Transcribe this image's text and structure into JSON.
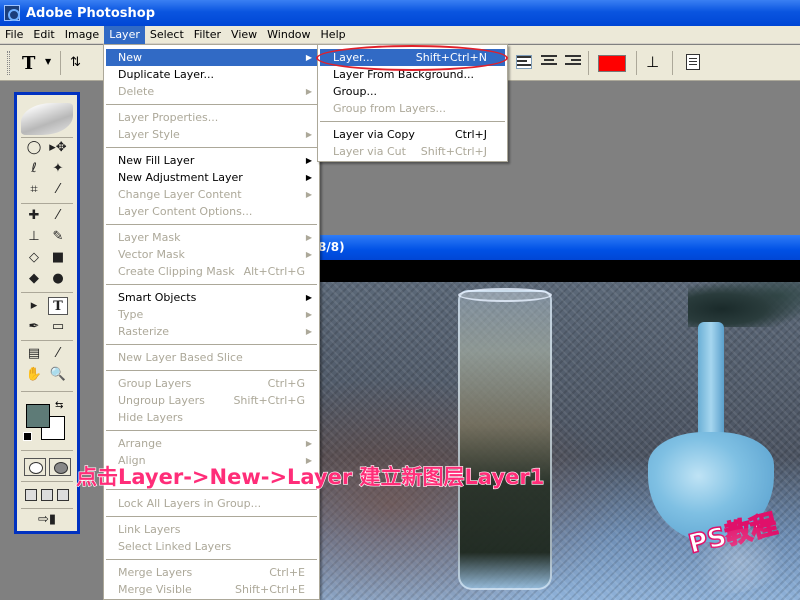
{
  "app": {
    "title": "Adobe Photoshop"
  },
  "menubar": {
    "items": [
      "File",
      "Edit",
      "Image",
      "Layer",
      "Select",
      "Filter",
      "View",
      "Window",
      "Help"
    ],
    "active": "Layer"
  },
  "options": {
    "type_tool_glyph": "T",
    "text_color": "#ff0000"
  },
  "document": {
    "title_fragment": "8/8)"
  },
  "layer_menu": {
    "items": [
      {
        "label": "New",
        "arrow": true,
        "disabled": false
      },
      {
        "label": "Duplicate Layer...",
        "disabled": false
      },
      {
        "label": "Delete",
        "arrow": true,
        "disabled": true
      },
      {
        "label": "Layer Properties...",
        "disabled": true
      },
      {
        "label": "Layer Style",
        "arrow": true,
        "disabled": true
      },
      {
        "label": "New Fill Layer",
        "arrow": true,
        "disabled": false
      },
      {
        "label": "New Adjustment Layer",
        "arrow": true,
        "disabled": false
      },
      {
        "label": "Change Layer Content",
        "arrow": true,
        "disabled": true
      },
      {
        "label": "Layer Content Options...",
        "disabled": true
      },
      {
        "label": "Layer Mask",
        "arrow": true,
        "disabled": true
      },
      {
        "label": "Vector Mask",
        "arrow": true,
        "disabled": true
      },
      {
        "label": "Create Clipping Mask",
        "shortcut": "Alt+Ctrl+G",
        "disabled": true
      },
      {
        "label": "Smart Objects",
        "arrow": true,
        "disabled": false
      },
      {
        "label": "Type",
        "arrow": true,
        "disabled": true
      },
      {
        "label": "Rasterize",
        "arrow": true,
        "disabled": true
      },
      {
        "label": "New Layer Based Slice",
        "disabled": true
      },
      {
        "label": "Group Layers",
        "shortcut": "Ctrl+G",
        "disabled": true
      },
      {
        "label": "Ungroup Layers",
        "shortcut": "Shift+Ctrl+G",
        "disabled": true
      },
      {
        "label": "Hide Layers",
        "disabled": true
      },
      {
        "label": "Arrange",
        "arrow": true,
        "disabled": true
      },
      {
        "label": "Align",
        "arrow": true,
        "disabled": true
      },
      {
        "label": "Lock All Layers in Group...",
        "disabled": true
      },
      {
        "label": "Link Layers",
        "disabled": true
      },
      {
        "label": "Select Linked Layers",
        "disabled": true
      },
      {
        "label": "Merge Layers",
        "shortcut": "Ctrl+E",
        "disabled": true
      },
      {
        "label": "Merge Visible",
        "shortcut": "Shift+Ctrl+E",
        "disabled": true
      }
    ]
  },
  "new_submenu": {
    "items": [
      {
        "label": "Layer...",
        "shortcut": "Shift+Ctrl+N",
        "disabled": false,
        "highlight": true
      },
      {
        "label": "Layer From Background...",
        "disabled": false
      },
      {
        "label": "Group...",
        "disabled": false
      },
      {
        "label": "Group from Layers...",
        "disabled": true
      },
      {
        "label": "Layer via Copy",
        "shortcut": "Ctrl+J",
        "disabled": false
      },
      {
        "label": "Layer via Cut",
        "shortcut": "Shift+Ctrl+J",
        "disabled": true
      }
    ]
  },
  "annotation": {
    "text": "点击Layer->New->Layer 建立新图层Layer1"
  },
  "watermark": {
    "text": "PS教程"
  },
  "toolbox": {
    "tools": [
      "◯",
      "▸✥",
      "ℓ",
      "✦",
      "⌗",
      "⁄",
      "✚",
      "⁄",
      "⊥",
      "✎",
      "◇",
      "■",
      "◆",
      "●",
      "▸",
      "T",
      "✒",
      "▭",
      "▤",
      "⁄",
      "✋",
      "🔍"
    ],
    "foreground_color": "#5e7b77",
    "background_color": "#ffffff"
  }
}
